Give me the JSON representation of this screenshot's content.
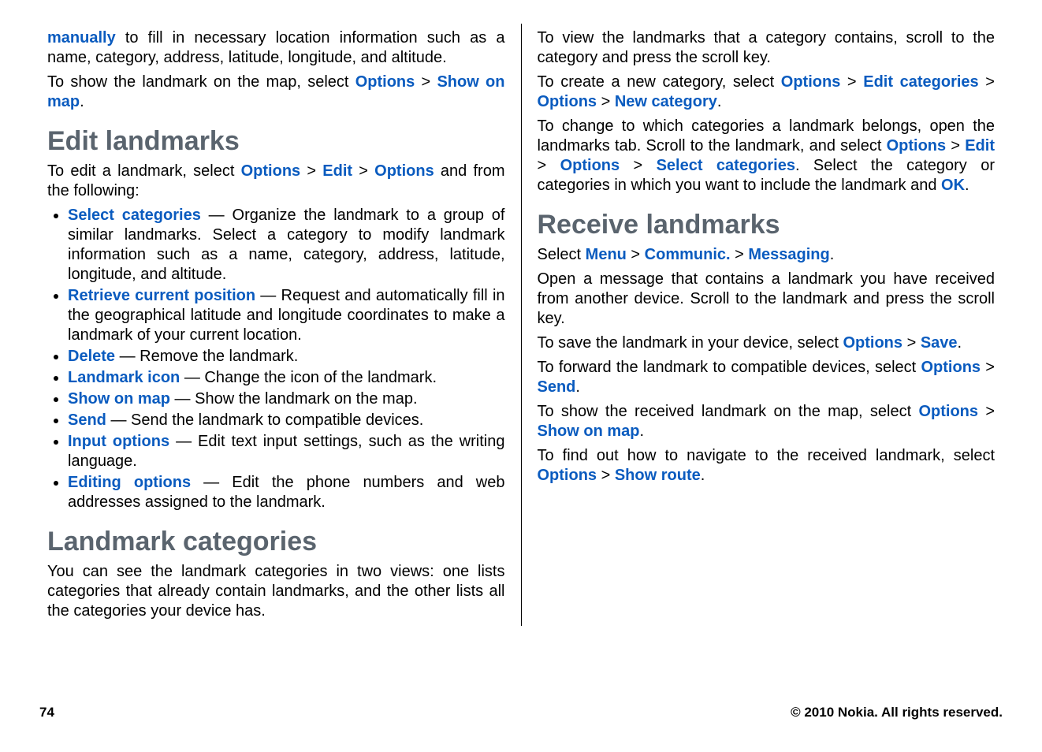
{
  "footer": {
    "page": "74",
    "copyright": "© 2010 Nokia. All rights reserved."
  },
  "left": {
    "intro1_a": "manually",
    "intro1_b": " to fill in necessary location information such as a name, category, address, latitude, longitude, and altitude.",
    "intro2_a": "To show the landmark on the map, select ",
    "intro2_opt": "Options",
    "intro2_sep": " > ",
    "intro2_show": "Show on map",
    "intro2_end": ".",
    "h_edit": "Edit landmarks",
    "edit_pre": "To edit a landmark, select ",
    "edit_opt1": "Options",
    "edit_sep": " > ",
    "edit_edit": "Edit",
    "edit_opt2": "Options",
    "edit_post": " and from the following:",
    "items": [
      {
        "label": "Select categories",
        "desc": " — Organize the landmark to a group of similar landmarks. Select a category to modify landmark information such as a name, category, address, latitude, longitude, and altitude."
      },
      {
        "label": "Retrieve current position",
        "desc": " — Request and automatically fill in the geographical latitude and longitude coordinates to make a landmark of your current location."
      },
      {
        "label": "Delete",
        "desc": " — Remove the landmark."
      },
      {
        "label": "Landmark icon",
        "desc": " — Change the icon of the landmark."
      },
      {
        "label": "Show on map",
        "desc": " — Show the landmark on the map."
      },
      {
        "label": "Send",
        "desc": " — Send the landmark to compatible devices."
      },
      {
        "label": "Input options",
        "desc": " — Edit text input settings, such as the writing language."
      },
      {
        "label": "Editing options",
        "desc": " — Edit the phone numbers and web addresses assigned to the landmark."
      }
    ],
    "h_cat": "Landmark categories",
    "cat_p": "You can see the landmark categories in two views: one lists categories that already contain landmarks, and the other lists all the categories your device has."
  },
  "right": {
    "r1": "To view the landmarks that a category contains, scroll to the category and press the scroll key.",
    "r2_pre": "To create a new category, select ",
    "r2_opt1": "Options",
    "r2_sep": " > ",
    "r2_editcat": "Edit categories",
    "r2_opt2": "Options",
    "r2_newcat": "New category",
    "r2_end": ".",
    "r3_pre": "To change to which categories a landmark belongs, open the landmarks tab. Scroll to the landmark, and select ",
    "r3_opt1": "Options",
    "r3_sep": " > ",
    "r3_edit": "Edit",
    "r3_opt2": "Options",
    "r3_selcat": "Select categories",
    "r3_mid": ". Select the category or categories in which you want to include the landmark and ",
    "r3_ok": "OK",
    "r3_end": ".",
    "h_recv": "Receive landmarks",
    "recv_pre": "Select ",
    "recv_menu": "Menu",
    "recv_sep": " > ",
    "recv_comm": "Communic.",
    "recv_msg": "Messaging",
    "recv_end": ".",
    "r4": "Open a message that contains a landmark you have received from another device. Scroll to the landmark and press the scroll key.",
    "r5_pre": "To save the landmark in your device, select ",
    "r5_opt": "Options",
    "r5_sep": " > ",
    "r5_save": "Save",
    "r5_end": ".",
    "r6_pre": "To forward the landmark to compatible devices, select ",
    "r6_opt": "Options",
    "r6_sep": " > ",
    "r6_send": "Send",
    "r6_end": ".",
    "r7_pre": "To show the received landmark on the map, select ",
    "r7_opt": "Options",
    "r7_sep": " > ",
    "r7_show": "Show on map",
    "r7_end": ".",
    "r8_pre": "To find out how to navigate to the received landmark, select ",
    "r8_opt": "Options",
    "r8_sep": " > ",
    "r8_route": "Show route",
    "r8_end": "."
  }
}
